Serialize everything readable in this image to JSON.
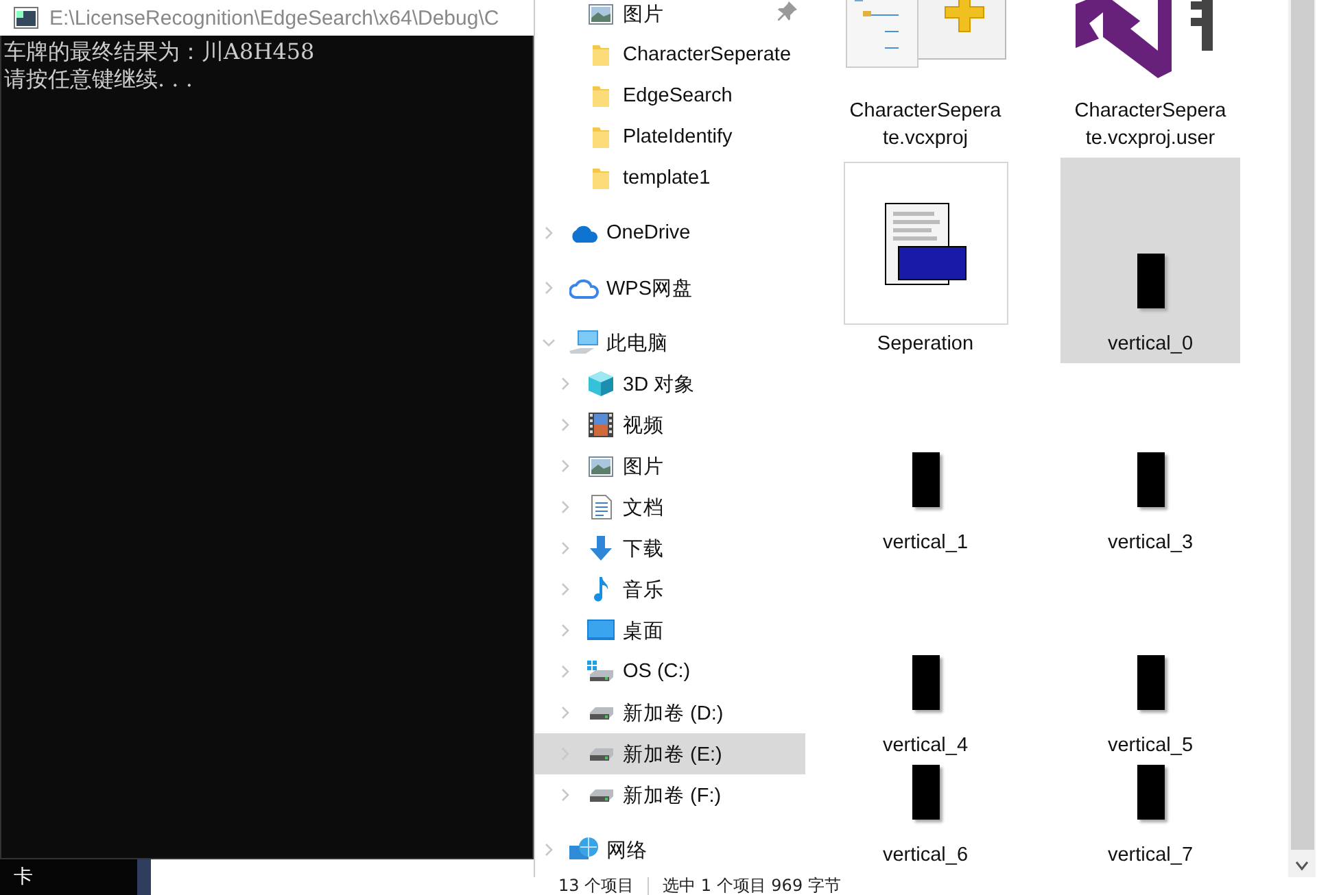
{
  "console": {
    "title": "E:\\LicenseRecognition\\EdgeSearch\\x64\\Debug\\C",
    "lines": [
      "车牌的最终结果为：川A8H458",
      "请按任意键继续. . ."
    ]
  },
  "desktop": {
    "label": "卡"
  },
  "navigation": {
    "quick_access_items": [
      {
        "label": "图片",
        "kind": "pictures",
        "pinned": true,
        "selected": false
      },
      {
        "label": "CharacterSeperate",
        "kind": "folder",
        "pinned": false,
        "selected": false
      },
      {
        "label": "EdgeSearch",
        "kind": "folder",
        "pinned": false,
        "selected": false
      },
      {
        "label": "PlateIdentify",
        "kind": "folder",
        "pinned": false,
        "selected": false
      },
      {
        "label": "template1",
        "kind": "folder",
        "pinned": false,
        "selected": false
      }
    ],
    "tree": [
      {
        "label": "OneDrive",
        "kind": "cloud",
        "expanded": false,
        "selected": false
      },
      {
        "label": "WPS网盘",
        "kind": "cloudoutline",
        "expanded": false,
        "selected": false
      },
      {
        "label": "此电脑",
        "kind": "computer",
        "expanded": true,
        "selected": false,
        "children": [
          {
            "label": "3D 对象",
            "kind": "cube",
            "expanded": false,
            "selected": false
          },
          {
            "label": "视频",
            "kind": "video",
            "expanded": false,
            "selected": false
          },
          {
            "label": "图片",
            "kind": "pictures",
            "expanded": false,
            "selected": false
          },
          {
            "label": "文档",
            "kind": "document",
            "expanded": false,
            "selected": false
          },
          {
            "label": "下载",
            "kind": "download",
            "expanded": false,
            "selected": false
          },
          {
            "label": "音乐",
            "kind": "music",
            "expanded": false,
            "selected": false
          },
          {
            "label": "桌面",
            "kind": "desktop",
            "expanded": false,
            "selected": false
          },
          {
            "label": "OS (C:)",
            "kind": "systemdrive",
            "expanded": false,
            "selected": false
          },
          {
            "label": "新加卷 (D:)",
            "kind": "drive",
            "expanded": false,
            "selected": false
          },
          {
            "label": "新加卷 (E:)",
            "kind": "drive",
            "expanded": false,
            "selected": true
          },
          {
            "label": "新加卷 (F:)",
            "kind": "drive",
            "expanded": false,
            "selected": false
          }
        ]
      },
      {
        "label": "网络",
        "kind": "network",
        "expanded": false,
        "selected": false
      }
    ]
  },
  "files": [
    {
      "name": "CharacterSeperate.vcxproj",
      "kind": "project",
      "selected": false
    },
    {
      "name": "CharacterSeperate.vcxproj.user",
      "kind": "vsuser",
      "selected": false
    },
    {
      "name": "Seperation",
      "kind": "cpp",
      "selected": false
    },
    {
      "name": "vertical_0",
      "kind": "image",
      "selected": true
    },
    {
      "name": "vertical_1",
      "kind": "image",
      "selected": false
    },
    {
      "name": "vertical_3",
      "kind": "image",
      "selected": false
    },
    {
      "name": "vertical_4",
      "kind": "image",
      "selected": false
    },
    {
      "name": "vertical_5",
      "kind": "image",
      "selected": false
    },
    {
      "name": "vertical_6",
      "kind": "image",
      "selected": false
    },
    {
      "name": "vertical_7",
      "kind": "image",
      "selected": false
    }
  ],
  "status_bar": {
    "item_count": "13 个项目",
    "selection": "选中 1 个项目 969 字节"
  }
}
